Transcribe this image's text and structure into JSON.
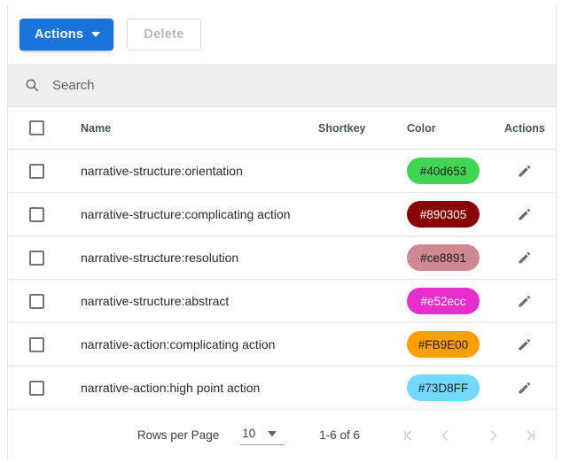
{
  "toolbar": {
    "actions_label": "Actions",
    "delete_label": "Delete"
  },
  "search": {
    "placeholder": "Search",
    "value": "",
    "icon": "search-icon"
  },
  "table": {
    "headers": {
      "checkbox": "",
      "name": "Name",
      "shortkey": "Shortkey",
      "color": "Color",
      "actions": "Actions"
    },
    "rows": [
      {
        "name": "narrative-structure:orientation",
        "shortkey": "",
        "color": "#40d653",
        "color_label": "#40d653",
        "color_text": "#1f1f1f"
      },
      {
        "name": "narrative-structure:complicating action",
        "shortkey": "",
        "color": "#890305",
        "color_label": "#890305",
        "color_text": "#ffffff"
      },
      {
        "name": "narrative-structure:resolution",
        "shortkey": "",
        "color": "#ce8891",
        "color_label": "#ce8891",
        "color_text": "#1f1f1f"
      },
      {
        "name": "narrative-structure:abstract",
        "shortkey": "",
        "color": "#e52ecc",
        "color_label": "#e52ecc",
        "color_text": "#ffffff"
      },
      {
        "name": "narrative-action:complicating action",
        "shortkey": "",
        "color": "#FB9E00",
        "color_label": "#FB9E00",
        "color_text": "#1f1f1f"
      },
      {
        "name": "narrative-action:high point action",
        "shortkey": "",
        "color": "#73D8FF",
        "color_label": "#73D8FF",
        "color_text": "#1f1f1f"
      }
    ]
  },
  "pagination": {
    "rows_per_page_label": "Rows per Page",
    "rows_per_page_value": "10",
    "rows_per_page_options": [
      "10"
    ],
    "range_label": "1-6 of 6",
    "first_page_icon": "first-page-icon",
    "prev_page_icon": "chevron-left-icon",
    "next_page_icon": "chevron-right-icon",
    "last_page_icon": "last-page-icon"
  },
  "colors": {
    "primary_button": "#1a73d8",
    "search_background": "#efefef",
    "border": "#e3e3e3"
  }
}
